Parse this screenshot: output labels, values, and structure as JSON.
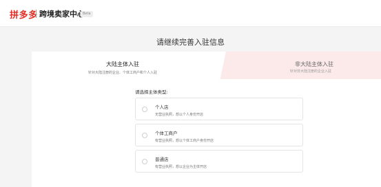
{
  "header": {
    "logo_text": "拼多多",
    "site_title": "跨境卖家中心",
    "beta_label": "Beta"
  },
  "page": {
    "heading": "请继续完善入驻信息"
  },
  "tabs": [
    {
      "title": "大陆主体入驻",
      "subtitle": "针对大陆注册的企业、个体工商户和个人入驻",
      "active": true
    },
    {
      "title": "非大陆主体入驻",
      "subtitle": "针对非大陆注册的企业入驻",
      "active": false
    }
  ],
  "form": {
    "prompt": "请选择主体类型:",
    "options": [
      {
        "title": "个人店",
        "desc": "无营业执照，想以个人身份开店"
      },
      {
        "title": "个体工商户",
        "desc": "有营业执照，想以个体工商户身份开店"
      },
      {
        "title": "普通店",
        "desc": "有营业执照，想以企业为主体开店"
      }
    ]
  },
  "colors": {
    "brand_red": "#e02e24",
    "inactive_tab_bg": "#fbeae9",
    "page_bg": "#f4f4f4"
  }
}
